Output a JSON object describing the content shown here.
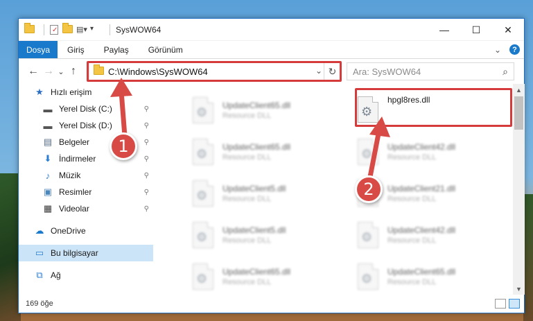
{
  "window": {
    "title": "SysWOW64",
    "controls": {
      "minimize": "—",
      "maximize": "☐",
      "close": "✕"
    }
  },
  "ribbon": {
    "tabs": [
      "Dosya",
      "Giriş",
      "Paylaş",
      "Görünüm"
    ],
    "collapse_icon": "⌄",
    "help_icon": "?"
  },
  "nav": {
    "back": "←",
    "forward": "→",
    "recent": "⌄",
    "up": "↑"
  },
  "address": {
    "path": "C:\\Windows\\SysWOW64",
    "dropdown": "⌄",
    "refresh": "↻"
  },
  "search": {
    "placeholder": "Ara: SysWOW64",
    "icon": "⌕"
  },
  "sidebar": {
    "items": [
      {
        "label": "Hızlı erişim",
        "icon": "star-icon",
        "glyph": "★",
        "color": "#2a6fc4",
        "pinned": false
      },
      {
        "label": "Yerel Disk (C:)",
        "icon": "drive-icon",
        "glyph": "▬",
        "color": "#555555",
        "pinned": true
      },
      {
        "label": "Yerel Disk (D:)",
        "icon": "drive-icon",
        "glyph": "▬",
        "color": "#555555",
        "pinned": true
      },
      {
        "label": "Belgeler",
        "icon": "documents-icon",
        "glyph": "▤",
        "color": "#5a6e86",
        "pinned": true
      },
      {
        "label": "İndirmeler",
        "icon": "download-icon",
        "glyph": "⬇",
        "color": "#2a7fd4",
        "pinned": true
      },
      {
        "label": "Müzik",
        "icon": "music-icon",
        "glyph": "♪",
        "color": "#2a7fd4",
        "pinned": true
      },
      {
        "label": "Resimler",
        "icon": "pictures-icon",
        "glyph": "▣",
        "color": "#4f86b8",
        "pinned": true
      },
      {
        "label": "Videolar",
        "icon": "videos-icon",
        "glyph": "▦",
        "color": "#3a3a3a",
        "pinned": true
      },
      {
        "label": "OneDrive",
        "icon": "onedrive-icon",
        "glyph": "☁",
        "color": "#1979ca",
        "pinned": false
      },
      {
        "label": "Bu bilgisayar",
        "icon": "computer-icon",
        "glyph": "▭",
        "color": "#2a7fd4",
        "pinned": false
      },
      {
        "label": "Ağ",
        "icon": "network-icon",
        "glyph": "⧉",
        "color": "#2a7fd4",
        "pinned": false
      }
    ],
    "pin_glyph": "📌"
  },
  "files": [
    {
      "name": "UpdateClient65.dll",
      "desc": "Resource DLL",
      "col": 0,
      "row": 0,
      "blurred": true
    },
    {
      "name": "hpgl8res.dll",
      "desc": "",
      "col": 1,
      "row": 0,
      "blurred": false
    },
    {
      "name": "UpdateClient65.dll",
      "desc": "Resource DLL",
      "col": 0,
      "row": 1,
      "blurred": true
    },
    {
      "name": "UpdateClient42.dll",
      "desc": "Resource DLL",
      "col": 1,
      "row": 1,
      "blurred": true
    },
    {
      "name": "UpdateClient5.dll",
      "desc": "Resource DLL",
      "col": 0,
      "row": 2,
      "blurred": true
    },
    {
      "name": "UpdateClient21.dll",
      "desc": "Resource DLL",
      "col": 1,
      "row": 2,
      "blurred": true
    },
    {
      "name": "UpdateClient5.dll",
      "desc": "Resource DLL",
      "col": 0,
      "row": 3,
      "blurred": true
    },
    {
      "name": "UpdateClient42.dll",
      "desc": "Resource DLL",
      "col": 1,
      "row": 3,
      "blurred": true
    },
    {
      "name": "UpdateClient65.dll",
      "desc": "Resource DLL",
      "col": 0,
      "row": 4,
      "blurred": true
    },
    {
      "name": "UpdateClient65.dll",
      "desc": "Resource DLL",
      "col": 1,
      "row": 4,
      "blurred": true
    }
  ],
  "status": {
    "count": "169 öğe"
  },
  "annotations": [
    {
      "number": "1",
      "color": "#d84a45"
    },
    {
      "number": "2",
      "color": "#d84a45"
    }
  ]
}
